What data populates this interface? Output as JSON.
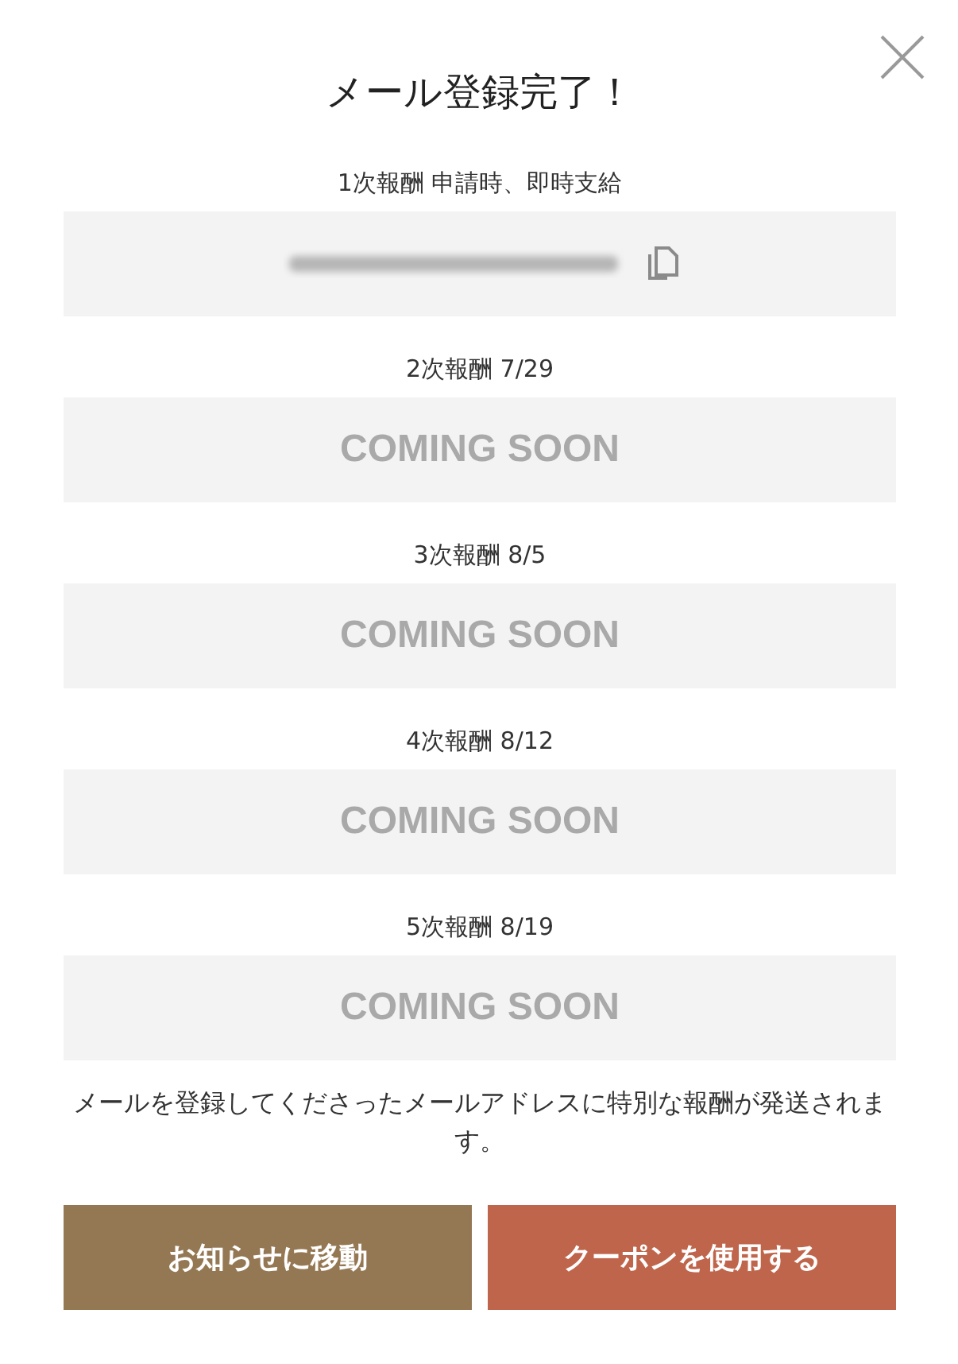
{
  "dialog": {
    "title": "メール登録完了！"
  },
  "rewards": [
    {
      "label": "1次報酬 申請時、即時支給",
      "kind": "code"
    },
    {
      "label": "2次報酬 7/29",
      "kind": "pending",
      "text": "COMING SOON"
    },
    {
      "label": "3次報酬 8/5",
      "kind": "pending",
      "text": "COMING SOON"
    },
    {
      "label": "4次報酬 8/12",
      "kind": "pending",
      "text": "COMING SOON"
    },
    {
      "label": "5次報酬 8/19",
      "kind": "pending",
      "text": "COMING SOON"
    }
  ],
  "notice": "メールを登録してくださったメールアドレスに特別な報酬が発送されます。",
  "buttons": [
    {
      "label": "お知らせに移動",
      "color": "#947853"
    },
    {
      "label": "クーポンを使用する",
      "color": "#bf654b"
    }
  ]
}
